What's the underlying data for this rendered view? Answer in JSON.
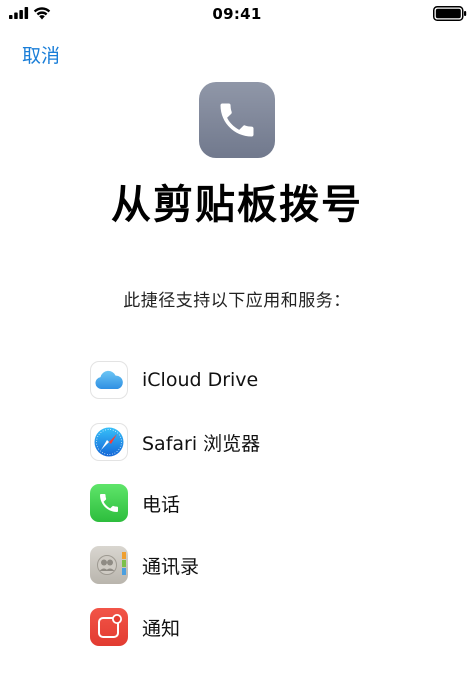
{
  "status": {
    "time": "09:41"
  },
  "nav": {
    "cancel_label": "取消"
  },
  "header": {
    "title": "从剪贴板拨号",
    "subtitle": "此捷径支持以下应用和服务："
  },
  "apps": [
    {
      "label": "iCloud Drive",
      "icon": "icloud-drive-icon"
    },
    {
      "label": "Safari 浏览器",
      "icon": "safari-icon"
    },
    {
      "label": "电话",
      "icon": "phone-icon"
    },
    {
      "label": "通讯录",
      "icon": "contacts-icon"
    },
    {
      "label": "通知",
      "icon": "notifications-icon"
    }
  ],
  "colors": {
    "accent": "#1a7ed8",
    "hero_icon": "#7d8498"
  }
}
